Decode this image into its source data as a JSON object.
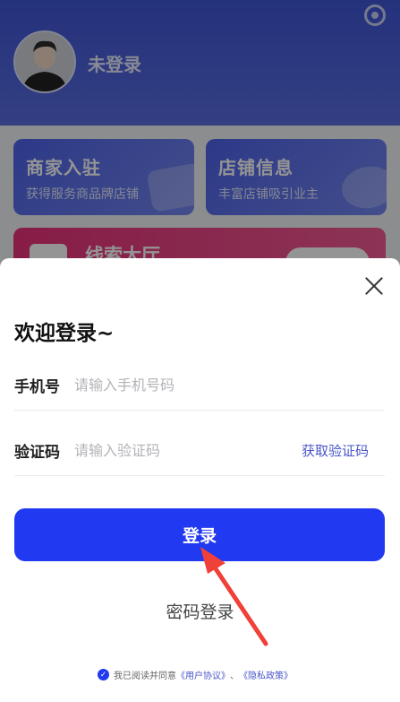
{
  "profile": {
    "user_name": "未登录"
  },
  "cards": [
    {
      "title": "商家入驻",
      "subtitle": "获得服务商品牌店铺"
    },
    {
      "title": "店铺信息",
      "subtitle": "丰富店铺吸引业主"
    }
  ],
  "banner": {
    "title": "线索大厅"
  },
  "login_sheet": {
    "title": "欢迎登录~",
    "phone_label": "手机号",
    "phone_placeholder": "请输入手机号码",
    "code_label": "验证码",
    "code_placeholder": "请输入验证码",
    "get_code_label": "获取验证码",
    "login_label": "登录",
    "password_login_label": "密码登录",
    "agreement_prefix": "我已阅读并同意",
    "user_agreement": "《用户协议》",
    "separator": "、",
    "privacy_policy": "《隐私政策》"
  },
  "colors": {
    "primary": "#2139f0",
    "link": "#4a56c8",
    "annotation_arrow": "#f0403a"
  }
}
